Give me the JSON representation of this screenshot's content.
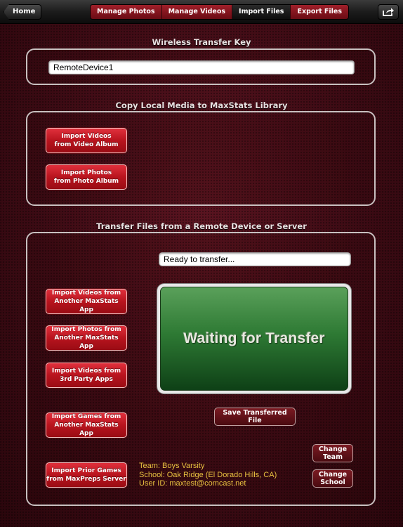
{
  "topbar": {
    "home_label": "Home",
    "tabs": [
      {
        "label": "Manage Photos",
        "active": false
      },
      {
        "label": "Manage Videos",
        "active": false
      },
      {
        "label": "Import Files",
        "active": true
      },
      {
        "label": "Export Files",
        "active": false
      }
    ],
    "share_icon": "share-icon"
  },
  "wireless": {
    "title": "Wireless Transfer Key",
    "value": "RemoteDevice1"
  },
  "copy_local": {
    "title": "Copy Local Media to MaxStats Library",
    "import_videos": "Import Videos\nfrom Video Album",
    "import_photos": "Import Photos\nfrom Photo Album"
  },
  "transfer": {
    "title": "Transfer Files from a Remote Device or Server",
    "status": "Ready to transfer...",
    "waiting": "Waiting for Transfer",
    "btn_videos_maxstats": "Import Videos from\nAnother MaxStats App",
    "btn_photos_maxstats": "Import Photos from\nAnother MaxStats App",
    "btn_videos_3rd": "Import Videos from\n3rd Party Apps",
    "btn_games_maxstats": "Import Games from\nAnother MaxStats App",
    "btn_prior_games": "Import Prior Games\nfrom MaxPreps Server",
    "save_label": "Save Transferred File",
    "change_team": "Change\nTeam",
    "change_school": "Change\nSchool",
    "team": "Team: Boys Varsity",
    "school": "School: Oak Ridge (El Dorado Hills, CA)",
    "user": "User ID: maxtest@comcast.net"
  },
  "colors": {
    "background": "#3a0a12",
    "button_red": "#c01820",
    "waiting_green": "#2e7a34",
    "info_text": "#e8c040"
  }
}
